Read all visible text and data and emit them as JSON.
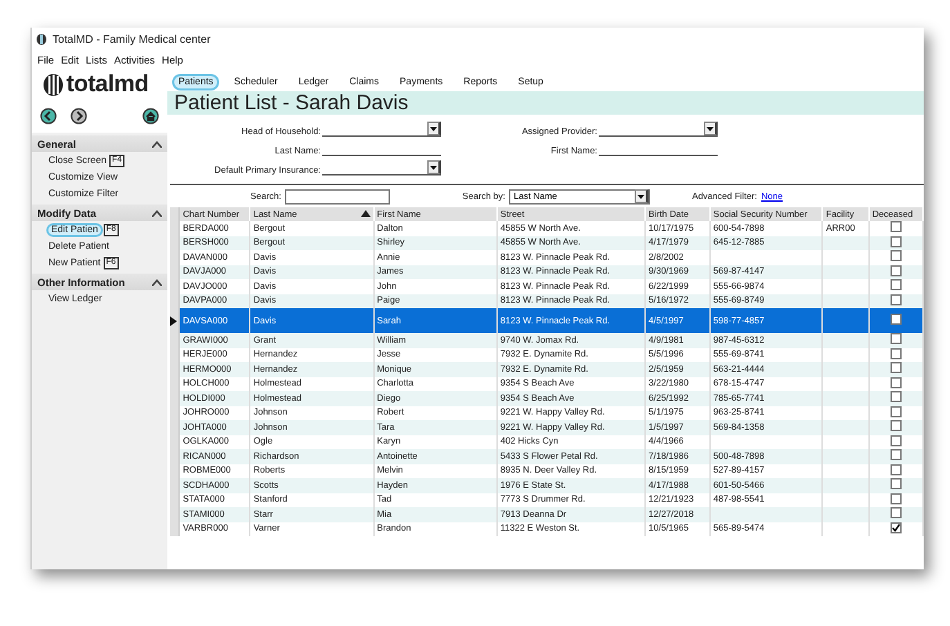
{
  "window": {
    "title": "TotalMD - Family Medical center"
  },
  "menu": [
    "File",
    "Edit",
    "Lists",
    "Activities",
    "Help"
  ],
  "logo": {
    "text": "totalmd"
  },
  "sidebar": {
    "sections": [
      {
        "title": "General",
        "expanded": true,
        "items": [
          {
            "label": "Close Screen",
            "key": "F4",
            "selected": false
          },
          {
            "label": "Customize View",
            "selected": false
          },
          {
            "label": "Customize Filter",
            "selected": false
          }
        ]
      },
      {
        "title": "Modify Data",
        "expanded": true,
        "items": [
          {
            "label": "Edit Patien",
            "key": "F8",
            "selected": true
          },
          {
            "label": "Delete Patient",
            "selected": false
          },
          {
            "label": "New Patient",
            "key": "F6",
            "selected": false
          }
        ]
      },
      {
        "title": "Other Information",
        "expanded": true,
        "items": [
          {
            "label": "View Ledger",
            "selected": false
          }
        ]
      }
    ]
  },
  "nav_tabs": [
    {
      "label": "Patients",
      "selected": true
    },
    {
      "label": "Scheduler",
      "selected": false
    },
    {
      "label": "Ledger",
      "selected": false
    },
    {
      "label": "Claims",
      "selected": false
    },
    {
      "label": "Payments",
      "selected": false
    },
    {
      "label": "Reports",
      "selected": false
    },
    {
      "label": "Setup",
      "selected": false
    }
  ],
  "page_title": "Patient List - Sarah Davis",
  "filters_left": [
    {
      "label": "Head of Household:",
      "kind": "dropdown"
    },
    {
      "label": "Last Name:",
      "kind": "text"
    },
    {
      "label": "Default Primary Insurance:",
      "kind": "dropdown"
    }
  ],
  "filters_right": [
    {
      "label": "Assigned Provider:",
      "kind": "dropdown"
    },
    {
      "label": "First Name:",
      "kind": "text"
    }
  ],
  "search": {
    "label": "Search:"
  },
  "search_by": {
    "label": "Search by:",
    "value": "Last Name"
  },
  "advanced_filter": {
    "label": "Advanced Filter:",
    "link": "None"
  },
  "table": {
    "columns": [
      {
        "label": "Chart Number",
        "sorted": false
      },
      {
        "label": "Last Name",
        "sorted": true
      },
      {
        "label": "First Name",
        "sorted": false
      },
      {
        "label": "Street",
        "sorted": false
      },
      {
        "label": "Birth Date",
        "sorted": false
      },
      {
        "label": "Social Security Number",
        "sorted": false
      },
      {
        "label": "Facility",
        "sorted": false
      },
      {
        "label": "Deceased",
        "sorted": false
      }
    ],
    "rows": [
      {
        "cells": [
          "BERDA000",
          "Bergout",
          "Dalton",
          "45855 W North Ave.",
          "10/17/1975",
          "600-54-7898",
          "ARR00"
        ],
        "deceased": false,
        "selected": false
      },
      {
        "cells": [
          "BERSH000",
          "Bergout",
          "Shirley",
          "45855 W North Ave.",
          "4/17/1979",
          "645-12-7885",
          ""
        ],
        "deceased": false,
        "selected": false
      },
      {
        "cells": [
          "DAVAN000",
          "Davis",
          "Annie",
          "8123 W. Pinnacle Peak Rd.",
          "2/8/2002",
          "",
          ""
        ],
        "deceased": false,
        "selected": false
      },
      {
        "cells": [
          "DAVJA000",
          "Davis",
          "James",
          "8123 W. Pinnacle Peak Rd.",
          "9/30/1969",
          "569-87-4147",
          ""
        ],
        "deceased": false,
        "selected": false
      },
      {
        "cells": [
          "DAVJO000",
          "Davis",
          "John",
          "8123 W. Pinnacle Peak Rd.",
          "6/22/1999",
          "555-66-9874",
          ""
        ],
        "deceased": false,
        "selected": false
      },
      {
        "cells": [
          "DAVPA000",
          "Davis",
          "Paige",
          "8123 W. Pinnacle Peak Rd.",
          "5/16/1972",
          "555-69-8749",
          ""
        ],
        "deceased": false,
        "selected": false
      },
      {
        "cells": [
          "DAVSA000",
          "Davis",
          "Sarah",
          "8123 W. Pinnacle Peak Rd.",
          "4/5/1997",
          "598-77-4857",
          ""
        ],
        "deceased": false,
        "selected": true
      },
      {
        "cells": [
          "GRAWI000",
          "Grant",
          "William",
          "9740 W. Jomax Rd.",
          "4/9/1981",
          "987-45-6312",
          ""
        ],
        "deceased": false,
        "selected": false
      },
      {
        "cells": [
          "HERJE000",
          "Hernandez",
          "Jesse",
          "7932 E. Dynamite Rd.",
          "5/5/1996",
          "555-69-8741",
          ""
        ],
        "deceased": false,
        "selected": false
      },
      {
        "cells": [
          "HERMO000",
          "Hernandez",
          "Monique",
          "7932 E. Dynamite Rd.",
          "2/5/1959",
          "563-21-4444",
          ""
        ],
        "deceased": false,
        "selected": false
      },
      {
        "cells": [
          "HOLCH000",
          "Holmestead",
          "Charlotta",
          "9354 S Beach Ave",
          "3/22/1980",
          "678-15-4747",
          ""
        ],
        "deceased": false,
        "selected": false
      },
      {
        "cells": [
          "HOLDI000",
          "Holmestead",
          "Diego",
          "9354 S Beach Ave",
          "6/25/1992",
          "785-65-7741",
          ""
        ],
        "deceased": false,
        "selected": false
      },
      {
        "cells": [
          "JOHRO000",
          "Johnson",
          "Robert",
          "9221 W. Happy Valley Rd.",
          "5/1/1975",
          "963-25-8741",
          ""
        ],
        "deceased": false,
        "selected": false
      },
      {
        "cells": [
          "JOHTA000",
          "Johnson",
          "Tara",
          "9221 W. Happy Valley Rd.",
          "1/5/1997",
          "569-84-1358",
          ""
        ],
        "deceased": false,
        "selected": false
      },
      {
        "cells": [
          "OGLKA000",
          "Ogle",
          "Karyn",
          "402 Hicks Cyn",
          "4/4/1966",
          "",
          ""
        ],
        "deceased": false,
        "selected": false
      },
      {
        "cells": [
          "RICAN000",
          "Richardson",
          "Antoinette",
          "5433 S Flower Petal Rd.",
          "7/18/1986",
          "500-48-7898",
          ""
        ],
        "deceased": false,
        "selected": false
      },
      {
        "cells": [
          "ROBME000",
          "Roberts",
          "Melvin",
          "8935 N. Deer Valley Rd.",
          "8/15/1959",
          "527-89-4157",
          ""
        ],
        "deceased": false,
        "selected": false
      },
      {
        "cells": [
          "SCDHA000",
          "Scotts",
          "Hayden",
          "1976 E State St.",
          "4/17/1988",
          "601-50-5466",
          ""
        ],
        "deceased": false,
        "selected": false
      },
      {
        "cells": [
          "STATA000",
          "Stanford",
          "Tad",
          "7773 S Drummer Rd.",
          "12/21/1923",
          "487-98-5541",
          ""
        ],
        "deceased": false,
        "selected": false
      },
      {
        "cells": [
          "STAMI000",
          "Starr",
          "Mia",
          "7913 Deanna Dr",
          "12/27/2018",
          "",
          ""
        ],
        "deceased": false,
        "selected": false
      },
      {
        "cells": [
          "VARBR000",
          "Varner",
          "Brandon",
          "11322 E Weston St.",
          "10/5/1965",
          "565-89-5474",
          ""
        ],
        "deceased": true,
        "selected": false
      }
    ]
  }
}
